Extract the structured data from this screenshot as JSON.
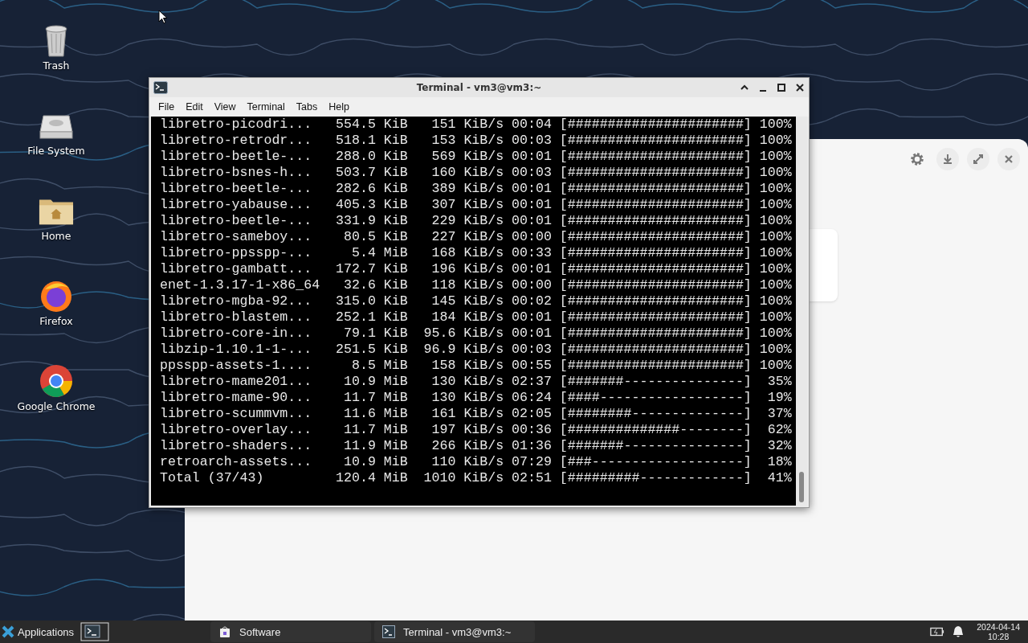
{
  "desktop_icons": [
    {
      "label": "Trash",
      "kind": "trash"
    },
    {
      "label": "File System",
      "kind": "drive"
    },
    {
      "label": "Home",
      "kind": "folder"
    },
    {
      "label": "Firefox",
      "kind": "firefox"
    },
    {
      "label": "Google Chrome",
      "kind": "chrome"
    }
  ],
  "terminal": {
    "title": "Terminal - vm3@vm3:~",
    "menu": [
      "File",
      "Edit",
      "View",
      "Terminal",
      "Tabs",
      "Help"
    ],
    "rows": [
      {
        "name": "libretro-picodri...",
        "size": "554.5 KiB",
        "speed": "151 KiB/s",
        "eta": "00:04",
        "bar": "[######################]",
        "percent": "100%"
      },
      {
        "name": "libretro-retrodr...",
        "size": "518.1 KiB",
        "speed": "153 KiB/s",
        "eta": "00:03",
        "bar": "[######################]",
        "percent": "100%"
      },
      {
        "name": "libretro-beetle-...",
        "size": "288.0 KiB",
        "speed": "569 KiB/s",
        "eta": "00:01",
        "bar": "[######################]",
        "percent": "100%"
      },
      {
        "name": "libretro-bsnes-h...",
        "size": "503.7 KiB",
        "speed": "160 KiB/s",
        "eta": "00:03",
        "bar": "[######################]",
        "percent": "100%"
      },
      {
        "name": "libretro-beetle-...",
        "size": "282.6 KiB",
        "speed": "389 KiB/s",
        "eta": "00:01",
        "bar": "[######################]",
        "percent": "100%"
      },
      {
        "name": "libretro-yabause...",
        "size": "405.3 KiB",
        "speed": "307 KiB/s",
        "eta": "00:01",
        "bar": "[######################]",
        "percent": "100%"
      },
      {
        "name": "libretro-beetle-...",
        "size": "331.9 KiB",
        "speed": "229 KiB/s",
        "eta": "00:01",
        "bar": "[######################]",
        "percent": "100%"
      },
      {
        "name": "libretro-sameboy...",
        "size": "80.5 KiB",
        "speed": "227 KiB/s",
        "eta": "00:00",
        "bar": "[######################]",
        "percent": "100%"
      },
      {
        "name": "libretro-ppsspp-...",
        "size": "5.4 MiB",
        "speed": "168 KiB/s",
        "eta": "00:33",
        "bar": "[######################]",
        "percent": "100%"
      },
      {
        "name": "libretro-gambatt...",
        "size": "172.7 KiB",
        "speed": "196 KiB/s",
        "eta": "00:01",
        "bar": "[######################]",
        "percent": "100%"
      },
      {
        "name": "enet-1.3.17-1-x86_64",
        "size": "32.6 KiB",
        "speed": "118 KiB/s",
        "eta": "00:00",
        "bar": "[######################]",
        "percent": "100%"
      },
      {
        "name": "libretro-mgba-92...",
        "size": "315.0 KiB",
        "speed": "145 KiB/s",
        "eta": "00:02",
        "bar": "[######################]",
        "percent": "100%"
      },
      {
        "name": "libretro-blastem...",
        "size": "252.1 KiB",
        "speed": "184 KiB/s",
        "eta": "00:01",
        "bar": "[######################]",
        "percent": "100%"
      },
      {
        "name": "libretro-core-in...",
        "size": "79.1 KiB",
        "speed": "95.6 KiB/s",
        "eta": "00:01",
        "bar": "[######################]",
        "percent": "100%"
      },
      {
        "name": "libzip-1.10.1-1-...",
        "size": "251.5 KiB",
        "speed": "96.9 KiB/s",
        "eta": "00:03",
        "bar": "[######################]",
        "percent": "100%"
      },
      {
        "name": "ppsspp-assets-1....",
        "size": "8.5 MiB",
        "speed": "158 KiB/s",
        "eta": "00:55",
        "bar": "[######################]",
        "percent": "100%"
      },
      {
        "name": "libretro-mame201...",
        "size": "10.9 MiB",
        "speed": "130 KiB/s",
        "eta": "02:37",
        "bar": "[#######---------------]",
        "percent": "35%"
      },
      {
        "name": "libretro-mame-90...",
        "size": "11.7 MiB",
        "speed": "130 KiB/s",
        "eta": "06:24",
        "bar": "[####------------------]",
        "percent": "19%"
      },
      {
        "name": "libretro-scummvm...",
        "size": "11.6 MiB",
        "speed": "161 KiB/s",
        "eta": "02:05",
        "bar": "[########--------------]",
        "percent": "37%"
      },
      {
        "name": "libretro-overlay...",
        "size": "11.7 MiB",
        "speed": "197 KiB/s",
        "eta": "00:36",
        "bar": "[##############--------]",
        "percent": "62%"
      },
      {
        "name": "libretro-shaders...",
        "size": "11.9 MiB",
        "speed": "266 KiB/s",
        "eta": "01:36",
        "bar": "[#######---------------]",
        "percent": "32%"
      },
      {
        "name": "retroarch-assets...",
        "size": "10.9 MiB",
        "speed": "110 KiB/s",
        "eta": "07:29",
        "bar": "[###-------------------]",
        "percent": "18%"
      },
      {
        "name": "Total (37/43)",
        "size": "120.4 MiB",
        "speed": "1010 KiB/s",
        "eta": "02:51",
        "bar": "[#########-------------]",
        "percent": "41%"
      }
    ]
  },
  "taskbar": {
    "menu_label": "Applications",
    "tasks": [
      {
        "label": "Software",
        "kind": "software"
      },
      {
        "label": "Terminal - vm3@vm3:~",
        "kind": "terminal"
      }
    ],
    "date": "2024-04-14",
    "time": "10:28"
  }
}
